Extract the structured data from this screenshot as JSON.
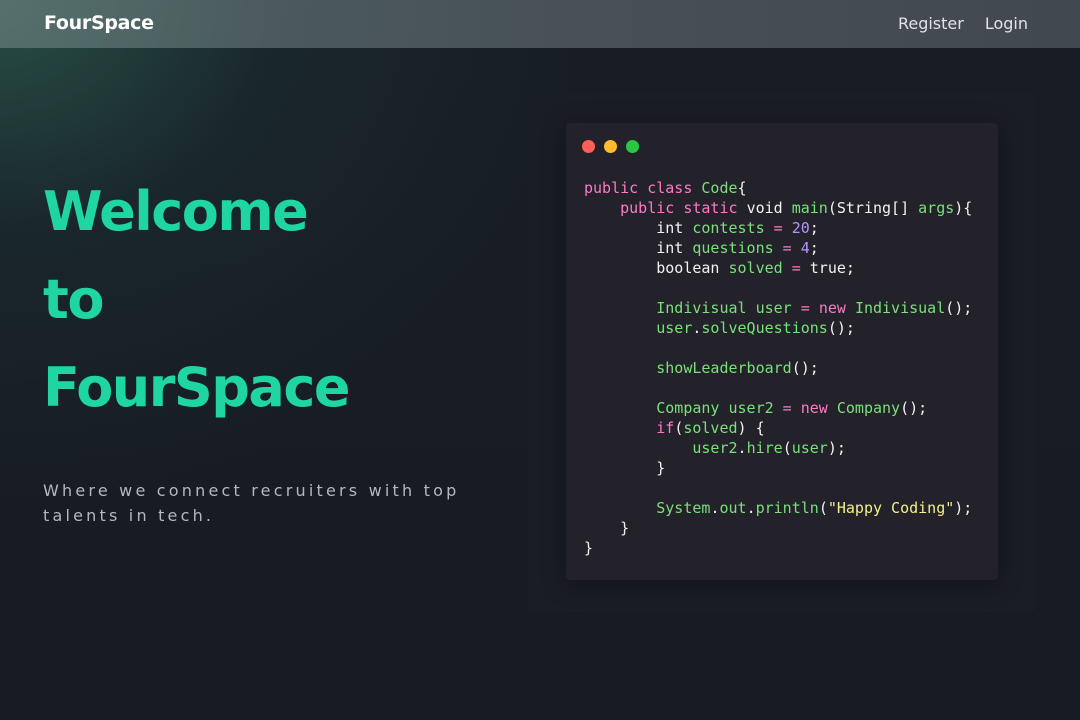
{
  "navbar": {
    "brand": "FourSpace",
    "links": [
      {
        "label": "Register"
      },
      {
        "label": "Login"
      }
    ]
  },
  "hero": {
    "title_lines": [
      "Welcome",
      "to",
      "FourSpace"
    ],
    "tagline": "Where we connect recruiters with top talents in tech."
  },
  "colors": {
    "accent": "#1fd6a3",
    "window_dot_red": "#ff5f57",
    "window_dot_yellow": "#febc2e",
    "window_dot_green": "#28c840",
    "code_keyword": "#ff79c6",
    "code_function": "#79e07a",
    "code_number": "#b594ff",
    "code_string": "#f5f08a"
  },
  "code_window": {
    "lines": [
      [
        {
          "t": "public class ",
          "c": "kw"
        },
        {
          "t": "Code",
          "c": "fn"
        },
        {
          "t": "{",
          "c": "plain"
        }
      ],
      [
        {
          "t": "    public static ",
          "c": "kw"
        },
        {
          "t": "void ",
          "c": "plain"
        },
        {
          "t": "main",
          "c": "fn"
        },
        {
          "t": "(String[] ",
          "c": "plain"
        },
        {
          "t": "args",
          "c": "fn"
        },
        {
          "t": "){",
          "c": "plain"
        }
      ],
      [
        {
          "t": "        int ",
          "c": "plain"
        },
        {
          "t": "contests",
          "c": "fn"
        },
        {
          "t": " = ",
          "c": "kw"
        },
        {
          "t": "20",
          "c": "num"
        },
        {
          "t": ";",
          "c": "plain"
        }
      ],
      [
        {
          "t": "        int ",
          "c": "plain"
        },
        {
          "t": "questions",
          "c": "fn"
        },
        {
          "t": " = ",
          "c": "kw"
        },
        {
          "t": "4",
          "c": "num"
        },
        {
          "t": ";",
          "c": "plain"
        }
      ],
      [
        {
          "t": "        boolean ",
          "c": "plain"
        },
        {
          "t": "solved",
          "c": "fn"
        },
        {
          "t": " = ",
          "c": "kw"
        },
        {
          "t": "true",
          "c": "plain"
        },
        {
          "t": ";",
          "c": "plain"
        }
      ],
      [],
      [
        {
          "t": "        Indivisual user",
          "c": "fn"
        },
        {
          "t": " = ",
          "c": "kw"
        },
        {
          "t": "new ",
          "c": "kw"
        },
        {
          "t": "Indivisual",
          "c": "fn"
        },
        {
          "t": "();",
          "c": "plain"
        }
      ],
      [
        {
          "t": "        user",
          "c": "fn"
        },
        {
          "t": ".",
          "c": "plain"
        },
        {
          "t": "solveQuestions",
          "c": "fn"
        },
        {
          "t": "();",
          "c": "plain"
        }
      ],
      [],
      [
        {
          "t": "        showLeaderboard",
          "c": "fn"
        },
        {
          "t": "();",
          "c": "plain"
        }
      ],
      [],
      [
        {
          "t": "        Company user2",
          "c": "fn"
        },
        {
          "t": " = ",
          "c": "kw"
        },
        {
          "t": "new ",
          "c": "kw"
        },
        {
          "t": "Company",
          "c": "fn"
        },
        {
          "t": "();",
          "c": "plain"
        }
      ],
      [
        {
          "t": "        if",
          "c": "kw"
        },
        {
          "t": "(",
          "c": "plain"
        },
        {
          "t": "solved",
          "c": "fn"
        },
        {
          "t": ") {",
          "c": "plain"
        }
      ],
      [
        {
          "t": "            user2",
          "c": "fn"
        },
        {
          "t": ".",
          "c": "plain"
        },
        {
          "t": "hire",
          "c": "fn"
        },
        {
          "t": "(",
          "c": "plain"
        },
        {
          "t": "user",
          "c": "fn"
        },
        {
          "t": ");",
          "c": "plain"
        }
      ],
      [
        {
          "t": "        }",
          "c": "plain"
        }
      ],
      [],
      [
        {
          "t": "        System",
          "c": "fn"
        },
        {
          "t": ".",
          "c": "plain"
        },
        {
          "t": "out",
          "c": "fn"
        },
        {
          "t": ".",
          "c": "plain"
        },
        {
          "t": "println",
          "c": "fn"
        },
        {
          "t": "(",
          "c": "plain"
        },
        {
          "t": "\"Happy Coding\"",
          "c": "str"
        },
        {
          "t": ");",
          "c": "plain"
        }
      ],
      [
        {
          "t": "    }",
          "c": "plain"
        }
      ],
      [
        {
          "t": "}",
          "c": "plain"
        }
      ]
    ]
  }
}
